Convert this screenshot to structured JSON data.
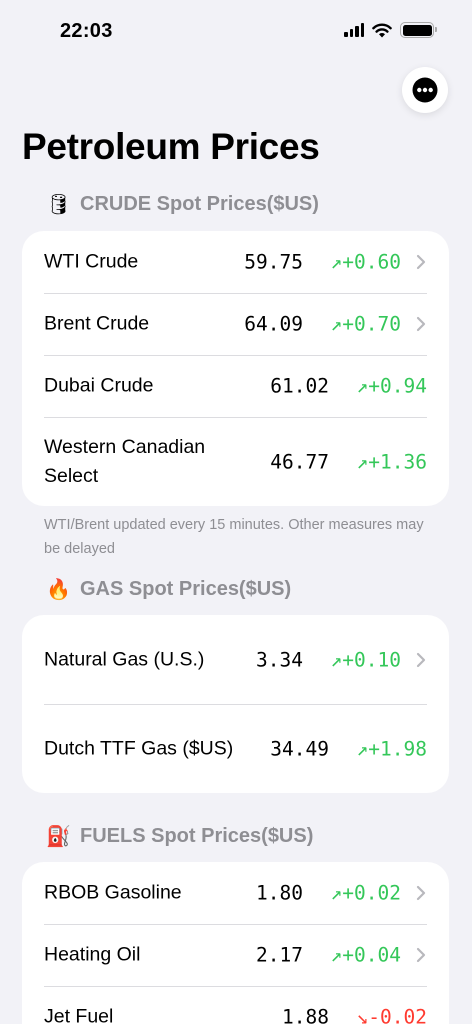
{
  "status_bar": {
    "time": "22:03"
  },
  "colors": {
    "up": "#34c759",
    "down": "#ff3b30",
    "secondary_text": "#8e8e93"
  },
  "header": {
    "title": "Petroleum Prices",
    "more_icon": "ellipsis-circle-icon"
  },
  "crude": {
    "icon": "🛢",
    "title": "CRUDE Spot Prices($US)",
    "rows": [
      {
        "name": "WTI Crude",
        "price": "59.75",
        "change": "+0.60",
        "direction": "up"
      },
      {
        "name": "Brent Crude",
        "price": "64.09",
        "change": "+0.70",
        "direction": "up"
      },
      {
        "name": "Dubai Crude",
        "price": "61.02",
        "change": "+0.94",
        "direction": "up"
      },
      {
        "name": "Western Canadian Select",
        "price": "46.77",
        "change": "+1.36",
        "direction": "up"
      }
    ],
    "footnote": "WTI/Brent updated every 15 minutes. Other measures may be delayed"
  },
  "gas": {
    "icon": "🔥",
    "title": "GAS Spot Prices($US)",
    "rows": [
      {
        "name": "Natural Gas (U.S.)",
        "price": "3.34",
        "change": "+0.10",
        "direction": "up"
      },
      {
        "name": "Dutch TTF Gas ($US)",
        "price": "34.49",
        "change": "+1.98",
        "direction": "up"
      }
    ]
  },
  "fuels": {
    "icon": "⛽",
    "title": "FUELS Spot Prices($US)",
    "rows": [
      {
        "name": "RBOB Gasoline",
        "price": "1.80",
        "change": "+0.02",
        "direction": "up"
      },
      {
        "name": "Heating Oil",
        "price": "2.17",
        "change": "+0.04",
        "direction": "up"
      },
      {
        "name": "Jet Fuel",
        "price": "1.88",
        "change": "-0.02",
        "direction": "down"
      }
    ]
  }
}
